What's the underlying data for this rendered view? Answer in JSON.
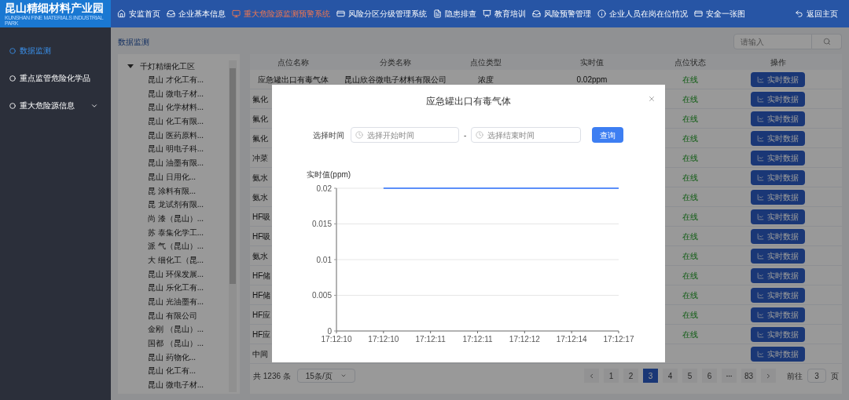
{
  "brand": {
    "title": "昆山精细材料产业园",
    "subtitle": "KUNSHAN FINE MATERIALS INDUSTRIAL PARK"
  },
  "nav": [
    {
      "label": "安监首页",
      "selected": false
    },
    {
      "label": "企业基本信息",
      "selected": false
    },
    {
      "label": "重大危险源监测预警系统",
      "selected": true
    },
    {
      "label": "风险分区分级管理系统",
      "selected": false
    },
    {
      "label": "隐患排查",
      "selected": false
    },
    {
      "label": "教育培训",
      "selected": false
    },
    {
      "label": "风险预警管理",
      "selected": false
    },
    {
      "label": "企业人员在岗在位情况",
      "selected": false
    },
    {
      "label": "安全一张图",
      "selected": false
    }
  ],
  "back_link": "返回主页",
  "sidebar": [
    {
      "label": "数据监测",
      "selected": true,
      "expandable": false
    },
    {
      "label": "重点监管危险化学品",
      "selected": false,
      "expandable": false
    },
    {
      "label": "重大危险源信息",
      "selected": false,
      "expandable": true
    }
  ],
  "breadcrumb": "数据监测",
  "search": {
    "placeholder": "请输入"
  },
  "tree": {
    "label": "千灯精细化工区",
    "expanded": true,
    "children": [
      {
        "label": "昆山 才化工有..."
      },
      {
        "label": "昆山 微电子材..."
      },
      {
        "label": "昆山 化学材料..."
      },
      {
        "label": "昆山 化工有限..."
      },
      {
        "label": "昆山 医药原料..."
      },
      {
        "label": "昆山 明电子科..."
      },
      {
        "label": "昆山 油墨有限..."
      },
      {
        "label": "昆山 日用化..."
      },
      {
        "label": "昆 涂料有限..."
      },
      {
        "label": "昆 龙试剂有限..."
      },
      {
        "label": "尚 漆（昆山）..."
      },
      {
        "label": "苏 泰集化学工..."
      },
      {
        "label": "派 气（昆山）..."
      },
      {
        "label": "大 细化工（昆..."
      },
      {
        "label": "昆山 环保发展..."
      },
      {
        "label": "昆山 乐化工有..."
      },
      {
        "label": "昆山 光油墨有..."
      },
      {
        "label": "昆山 有限公司"
      },
      {
        "label": "金刚 （昆山）..."
      },
      {
        "label": "国都 （昆山）..."
      },
      {
        "label": "昆山 药物化..."
      },
      {
        "label": "昆山 化工有..."
      },
      {
        "label": "昆山 微电子材..."
      }
    ]
  },
  "table": {
    "columns": [
      "点位名称",
      "分类名称",
      "点位类型",
      "实时值",
      "点位状态",
      "操作"
    ],
    "rows": [
      {
        "name": "应急罐出口有毒气体",
        "category": "昆山欣谷微电子材料有限公司",
        "type": "浓度",
        "value": "0.02ppm",
        "status": "在线",
        "action": "实时数据"
      },
      {
        "name": "氟化",
        "status": "在线",
        "action": "实时数据"
      },
      {
        "name": "氟化",
        "status": "在线",
        "action": "实时数据"
      },
      {
        "name": "氟化",
        "status": "在线",
        "action": "实时数据"
      },
      {
        "name": "冲菜",
        "status": "在线",
        "action": "实时数据"
      },
      {
        "name": "氨水",
        "status": "在线",
        "action": "实时数据"
      },
      {
        "name": "氨水",
        "status": "在线",
        "action": "实时数据"
      },
      {
        "name": "HF吸",
        "status": "在线",
        "action": "实时数据"
      },
      {
        "name": "HF吸",
        "status": "在线",
        "action": "实时数据"
      },
      {
        "name": "氨水",
        "status": "在线",
        "action": "实时数据"
      },
      {
        "name": "HF储",
        "status": "在线",
        "action": "实时数据"
      },
      {
        "name": "HF储",
        "status": "在线",
        "action": "实时数据"
      },
      {
        "name": "HF应",
        "status": "在线",
        "action": "实时数据"
      },
      {
        "name": "HF应",
        "status": "在线",
        "action": "实时数据"
      },
      {
        "name": "中间",
        "action": "实时数据"
      }
    ]
  },
  "pagination": {
    "total": "共 1236 条",
    "page_size": "15条/页",
    "pages": [
      {
        "label": "1",
        "selected": false
      },
      {
        "label": "2",
        "selected": false
      },
      {
        "label": "3",
        "selected": true
      },
      {
        "label": "4",
        "selected": false
      },
      {
        "label": "5",
        "selected": false
      },
      {
        "label": "6",
        "selected": false
      },
      {
        "label": "83",
        "selected": false
      }
    ],
    "goto_label": "前往",
    "goto_value": "3",
    "goto_unit": "页"
  },
  "modal": {
    "title": "应急罐出口有毒气体",
    "time_label": "选择时间",
    "start_placeholder": "选择开始时间",
    "separator": "-",
    "end_placeholder": "选择结束时间",
    "query_button": "查询",
    "chart_data": {
      "type": "line",
      "ylabel": "实时值(ppm)",
      "grid": true,
      "categories": [
        "17:12:10",
        "17:12:10",
        "17:12:11",
        "17:12:11",
        "17:12:12",
        "17:12:14",
        "17:12:17"
      ],
      "ylim": [
        0,
        0.02
      ],
      "yticks": [
        0,
        0.005,
        0.01,
        0.015,
        0.02
      ],
      "series": [
        {
          "color": "#5b8ff9",
          "values": [
            null,
            0.02,
            0.02,
            0.02,
            0.02,
            0.02,
            0.02
          ]
        }
      ]
    }
  }
}
